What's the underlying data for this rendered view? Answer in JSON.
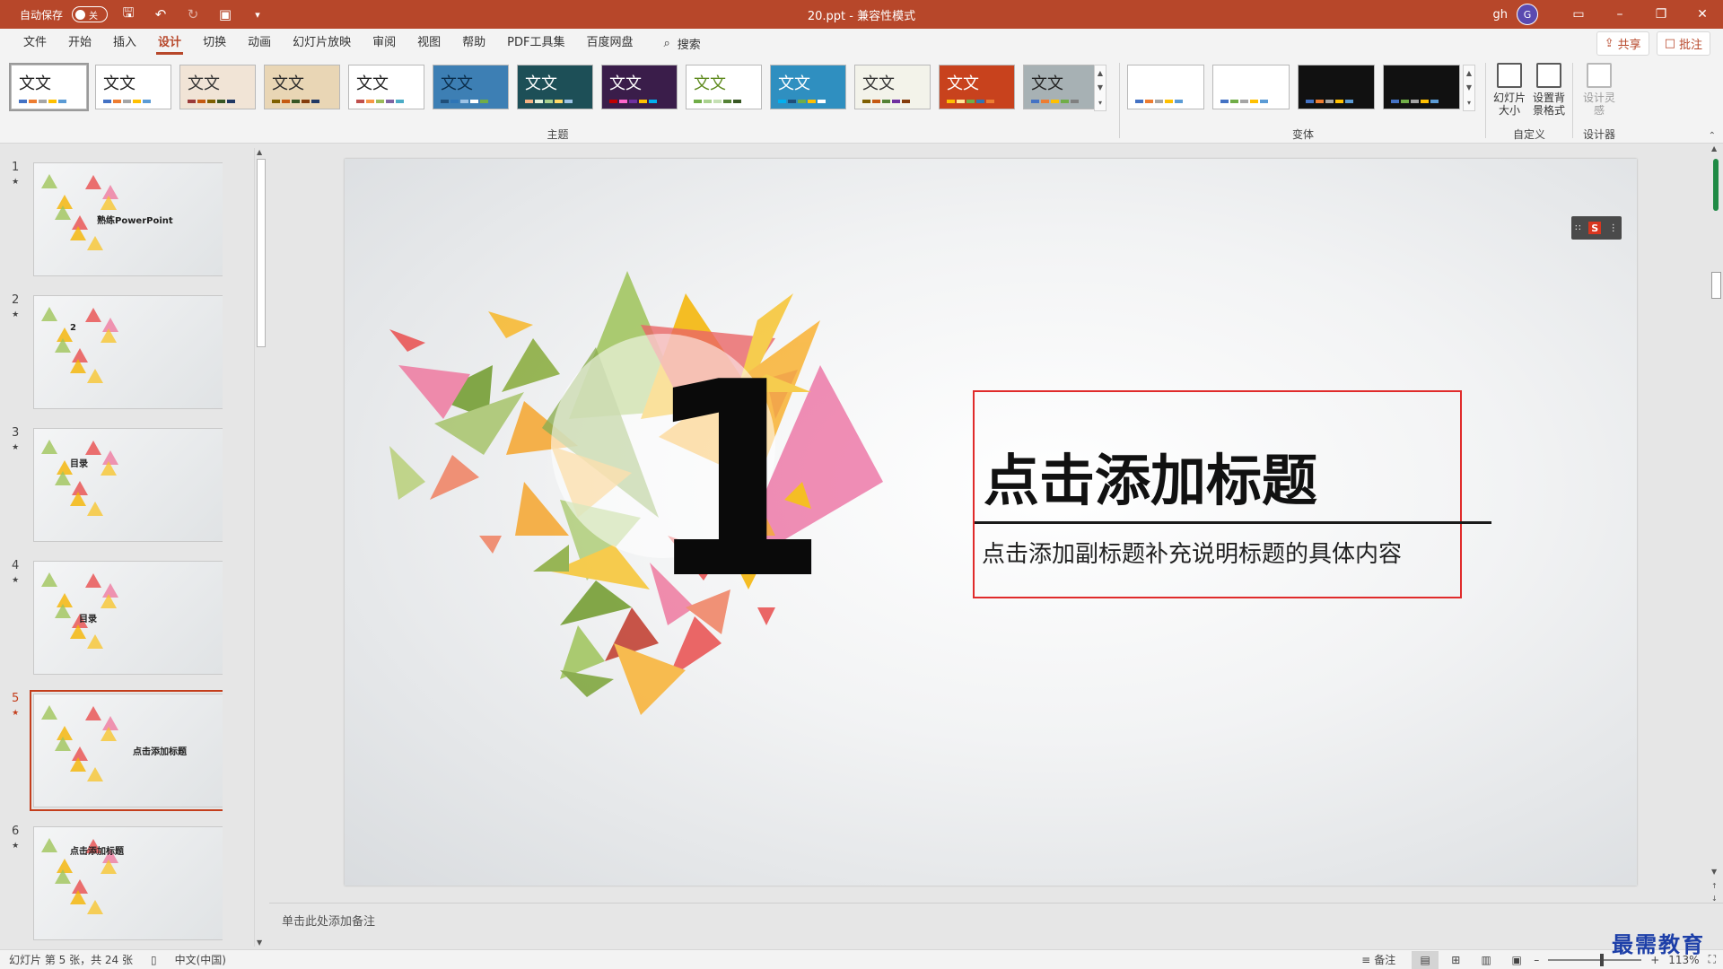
{
  "titlebar": {
    "autosave_label": "自动保存",
    "autosave_state": "关",
    "doc_title": "20.ppt - 兼容性模式",
    "user_name": "gh",
    "avatar_initial": "G"
  },
  "menu": {
    "tabs": [
      "文件",
      "开始",
      "插入",
      "设计",
      "切换",
      "动画",
      "幻灯片放映",
      "审阅",
      "视图",
      "帮助",
      "PDF工具集",
      "百度网盘"
    ],
    "active_tab": "设计",
    "search_label": "搜索",
    "share_label": "共享",
    "comments_label": "批注"
  },
  "ribbon": {
    "themes_group_label": "主题",
    "variants_group_label": "变体",
    "customize_group_label": "自定义",
    "designer_group_label": "设计器",
    "theme_sample_text": "文文",
    "slide_size_label": "幻灯片大小",
    "format_bg_label": "设置背景格式",
    "design_ideas_label": "设计灵感"
  },
  "themes": [
    {
      "bg": "#ffffff",
      "text": "#222222",
      "bars": [
        "#4472c4",
        "#ed7d31",
        "#a5a5a5",
        "#ffc000",
        "#5b9bd5"
      ]
    },
    {
      "bg": "#ffffff",
      "text": "#222222",
      "bars": [
        "#4472c4",
        "#ed7d31",
        "#a5a5a5",
        "#ffc000",
        "#5b9bd5"
      ]
    },
    {
      "bg": "#f1e4d6",
      "text": "#333333",
      "bars": [
        "#9b3a3a",
        "#c55a11",
        "#7f6000",
        "#375623",
        "#203864"
      ]
    },
    {
      "bg": "#e9d6b5",
      "text": "#2a2a2a",
      "bars": [
        "#7f6000",
        "#c55a11",
        "#375623",
        "#843c0c",
        "#203864"
      ]
    },
    {
      "bg": "#ffffff",
      "text": "#222222",
      "bars": [
        "#c0504d",
        "#f79646",
        "#9bbb59",
        "#8064a2",
        "#4bacc6"
      ]
    },
    {
      "bg": "#3d7fb4",
      "text": "#0b2d4a",
      "bars": [
        "#1f4e79",
        "#2e75b6",
        "#9dc3e6",
        "#ffffff",
        "#70ad47"
      ]
    },
    {
      "bg": "#1d4f57",
      "text": "#ffffff",
      "bars": [
        "#f4b183",
        "#e2f0d9",
        "#a9d18e",
        "#ffd966",
        "#9dc3e6"
      ]
    },
    {
      "bg": "#3a1d4a",
      "text": "#ffffff",
      "bars": [
        "#c00000",
        "#ff66cc",
        "#7030a0",
        "#ffc000",
        "#00b0f0"
      ]
    },
    {
      "bg": "#ffffff",
      "text": "#5e8a1e",
      "bars": [
        "#70ad47",
        "#a9d18e",
        "#c5e0b4",
        "#548235",
        "#375623"
      ]
    },
    {
      "bg": "#2f8fc0",
      "text": "#ffffff",
      "bars": [
        "#00b0f0",
        "#1f4e79",
        "#70ad47",
        "#ffc000",
        "#ffffff"
      ]
    },
    {
      "bg": "#f3f3ea",
      "text": "#333333",
      "bars": [
        "#7f6000",
        "#c55a11",
        "#548235",
        "#7030a0",
        "#843c0c"
      ]
    },
    {
      "bg": "#c8421d",
      "text": "#ffffff",
      "bars": [
        "#ffc000",
        "#ffe699",
        "#70ad47",
        "#2e75b6",
        "#ed7d31"
      ]
    },
    {
      "bg": "#a7b1b4",
      "text": "#222222",
      "bars": [
        "#4472c4",
        "#ed7d31",
        "#ffc000",
        "#70ad47",
        "#7f7f7f"
      ]
    }
  ],
  "variants": [
    {
      "bg": "#ffffff",
      "bars": [
        "#4472c4",
        "#ed7d31",
        "#a5a5a5",
        "#ffc000",
        "#5b9bd5"
      ]
    },
    {
      "bg": "#ffffff",
      "bars": [
        "#4472c4",
        "#70ad47",
        "#a5a5a5",
        "#ffc000",
        "#5b9bd5"
      ]
    },
    {
      "bg": "#111111",
      "bars": [
        "#4472c4",
        "#ed7d31",
        "#a5a5a5",
        "#ffc000",
        "#5b9bd5"
      ]
    },
    {
      "bg": "#111111",
      "bars": [
        "#4472c4",
        "#70ad47",
        "#a5a5a5",
        "#ffc000",
        "#5b9bd5"
      ]
    }
  ],
  "thumbnails": [
    {
      "num": "1",
      "label": "熟练PowerPoint"
    },
    {
      "num": "2",
      "label": "2"
    },
    {
      "num": "3",
      "label": "目录"
    },
    {
      "num": "4",
      "label": "目录"
    },
    {
      "num": "5",
      "label": "点击添加标题"
    },
    {
      "num": "6",
      "label": "点击添加标题"
    }
  ],
  "active_slide": "5",
  "slide": {
    "number": "1",
    "title": "点击添加标题",
    "subtitle": "点击添加副标题补充说明标题的具体内容"
  },
  "notes_placeholder": "单击此处添加备注",
  "status": {
    "slide_info": "幻灯片 第 5 张，共 24 张",
    "language": "中文(中国)",
    "notes_label": "备注",
    "zoom": "113%"
  },
  "watermark": "最需教育",
  "colors": {
    "accent": "#b7472a",
    "selection": "#c43e1c",
    "title_box_border": "#e02b2b"
  }
}
